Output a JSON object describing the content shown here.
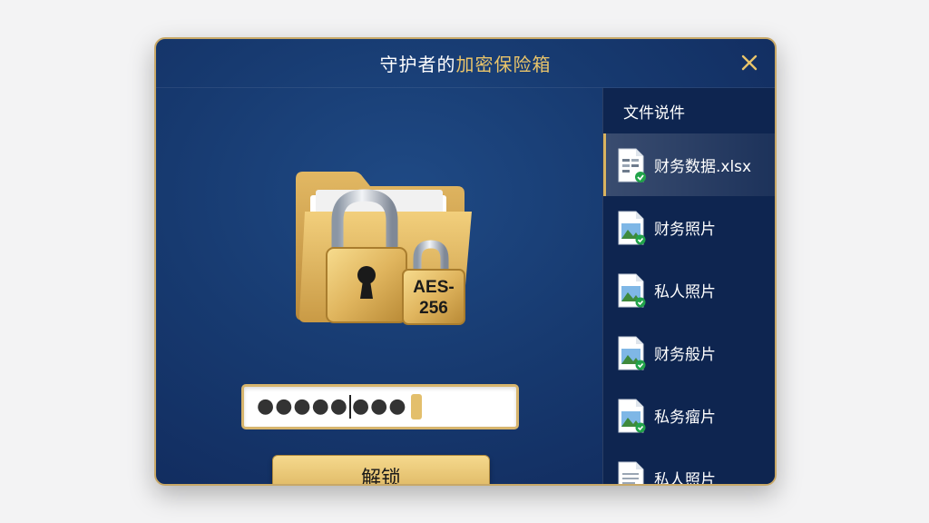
{
  "window": {
    "title_prefix": "守护者的",
    "title_accent": "加密保险箱",
    "close_label": "×"
  },
  "vault": {
    "badge_line1": "AES-",
    "badge_line2": "256"
  },
  "password": {
    "masked_before_caret": "●●●●●",
    "masked_after_caret": "●●●"
  },
  "unlock_button": {
    "label": "解锁"
  },
  "sidebar": {
    "title": "文件说件",
    "files": [
      {
        "name": "财务数据.xlsx",
        "icon": "spreadsheet-file-icon",
        "selected": true
      },
      {
        "name": "财务照片",
        "icon": "image-file-icon",
        "selected": false
      },
      {
        "name": "私人照片",
        "icon": "image-file-icon",
        "selected": false
      },
      {
        "name": "财务般片",
        "icon": "image-file-icon",
        "selected": false
      },
      {
        "name": "私务瘤片",
        "icon": "image-file-icon",
        "selected": false
      },
      {
        "name": "私人照片",
        "icon": "document-file-icon",
        "selected": false
      }
    ]
  },
  "colors": {
    "accent_gold": "#e9c46a",
    "window_bg": "#173a70",
    "sidebar_bg": "#0e2550",
    "check_green": "#22a34a"
  }
}
